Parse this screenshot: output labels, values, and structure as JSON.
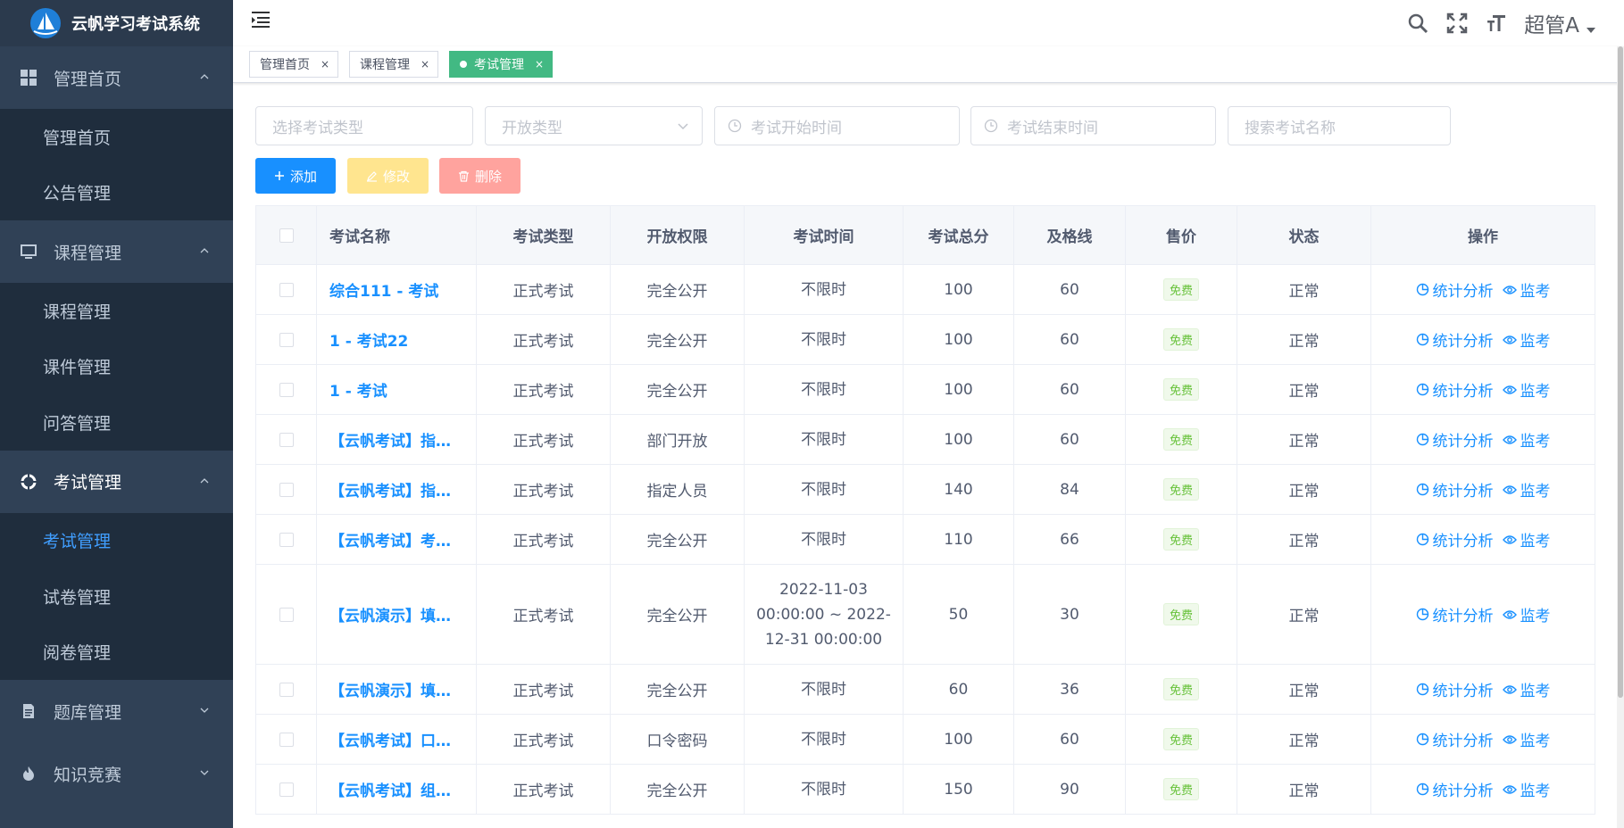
{
  "app": {
    "title": "云帆学习考试系统"
  },
  "sidebar": {
    "groups": [
      {
        "label": "管理首页",
        "icon": "dashboard-icon",
        "items": [
          {
            "label": "管理首页"
          },
          {
            "label": "公告管理"
          }
        ]
      },
      {
        "label": "课程管理",
        "icon": "monitor-icon",
        "items": [
          {
            "label": "课程管理"
          },
          {
            "label": "课件管理"
          },
          {
            "label": "问答管理"
          }
        ]
      },
      {
        "label": "考试管理",
        "icon": "lifebuoy-icon",
        "items": [
          {
            "label": "考试管理",
            "active": true
          },
          {
            "label": "试卷管理"
          },
          {
            "label": "阅卷管理"
          }
        ]
      },
      {
        "label": "题库管理",
        "icon": "document-icon",
        "items": []
      },
      {
        "label": "知识竞赛",
        "icon": "fire-icon",
        "items": []
      }
    ]
  },
  "header": {
    "user": "超管A"
  },
  "tags": [
    {
      "label": "管理首页",
      "active": false
    },
    {
      "label": "课程管理",
      "active": false
    },
    {
      "label": "考试管理",
      "active": true
    }
  ],
  "filters": {
    "exam_type_placeholder": "选择考试类型",
    "open_type_placeholder": "开放类型",
    "start_time_placeholder": "考试开始时间",
    "end_time_placeholder": "考试结束时间",
    "search_placeholder": "搜索考试名称"
  },
  "toolbar": {
    "add_label": "添加",
    "edit_label": "修改",
    "delete_label": "删除"
  },
  "table": {
    "columns": [
      "考试名称",
      "考试类型",
      "开放权限",
      "考试时间",
      "考试总分",
      "及格线",
      "售价",
      "状态",
      "操作"
    ],
    "stats_label": "统计分析",
    "monitor_label": "监考",
    "rows": [
      {
        "name": "综合111 - 考试",
        "type": "正式考试",
        "access": "完全公开",
        "time": "不限时",
        "total": "100",
        "pass": "60",
        "price": "免费",
        "status": "正常"
      },
      {
        "name": "1 - 考试22",
        "type": "正式考试",
        "access": "完全公开",
        "time": "不限时",
        "total": "100",
        "pass": "60",
        "price": "免费",
        "status": "正常"
      },
      {
        "name": "1 - 考试",
        "type": "正式考试",
        "access": "完全公开",
        "time": "不限时",
        "total": "100",
        "pass": "60",
        "price": "免费",
        "status": "正常"
      },
      {
        "name": "【云帆考试】指…",
        "type": "正式考试",
        "access": "部门开放",
        "time": "不限时",
        "total": "100",
        "pass": "60",
        "price": "免费",
        "status": "正常"
      },
      {
        "name": "【云帆考试】指…",
        "type": "正式考试",
        "access": "指定人员",
        "time": "不限时",
        "total": "140",
        "pass": "84",
        "price": "免费",
        "status": "正常"
      },
      {
        "name": "【云帆考试】考…",
        "type": "正式考试",
        "access": "完全公开",
        "time": "不限时",
        "total": "110",
        "pass": "66",
        "price": "免费",
        "status": "正常"
      },
      {
        "name": "【云帆演示】填…",
        "type": "正式考试",
        "access": "完全公开",
        "time": "2022-11-03 00:00:00 ~ 2022-12-31 00:00:00",
        "total": "50",
        "pass": "30",
        "price": "免费",
        "status": "正常"
      },
      {
        "name": "【云帆演示】填…",
        "type": "正式考试",
        "access": "完全公开",
        "time": "不限时",
        "total": "60",
        "pass": "36",
        "price": "免费",
        "status": "正常"
      },
      {
        "name": "【云帆考试】口…",
        "type": "正式考试",
        "access": "口令密码",
        "time": "不限时",
        "total": "100",
        "pass": "60",
        "price": "免费",
        "status": "正常"
      },
      {
        "name": "【云帆考试】组…",
        "type": "正式考试",
        "access": "完全公开",
        "time": "不限时",
        "total": "150",
        "pass": "90",
        "price": "免费",
        "status": "正常"
      }
    ]
  }
}
